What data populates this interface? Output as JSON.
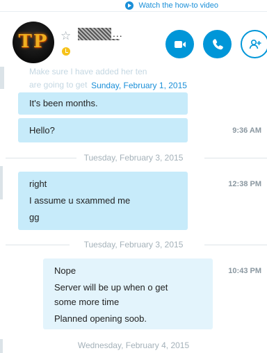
{
  "top_link": {
    "label": "Watch the how-to video"
  },
  "header": {
    "avatar_text": "TP",
    "contact_name_tail": "..."
  },
  "conversation": {
    "ghost_lines": [
      "Make sure I have added her ten",
      "are going to get"
    ],
    "groups": [
      {
        "date": "Sunday, February 1, 2015",
        "messages": [
          {
            "text": "It's been months.",
            "time": ""
          },
          {
            "text": "Hello?",
            "time": "9:36 AM"
          }
        ]
      },
      {
        "date": "Tuesday, February 3, 2015",
        "time": "12:38 PM",
        "messages": [
          "right",
          "I assume u sxammed me",
          "gg"
        ]
      },
      {
        "date": "Tuesday, February 3, 2015",
        "time": "10:43 PM",
        "messages": [
          "Nope",
          "Server will be up when o get",
          "some more time",
          "Planned opening soob."
        ]
      },
      {
        "date": "Wednesday, February 4, 2015"
      }
    ]
  },
  "colors": {
    "accent": "#0096d8",
    "incoming_bubble": "#c7ebfa",
    "outgoing_bubble": "#e3f4fc",
    "date_blue": "#1a8fd8"
  },
  "icons": [
    "play-icon",
    "star-icon",
    "away-status-icon",
    "video-call-icon",
    "phone-icon",
    "add-contact-icon"
  ]
}
